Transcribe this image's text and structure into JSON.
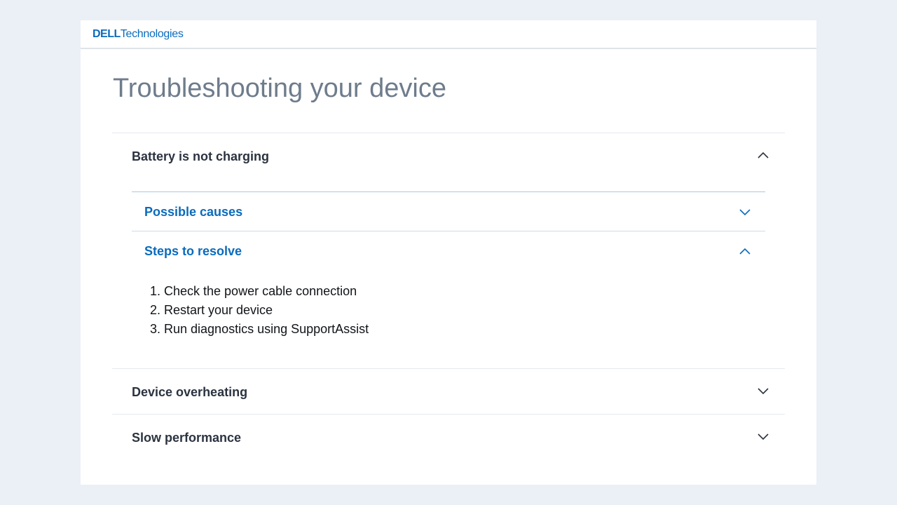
{
  "brand": {
    "logo_dell": "DELL",
    "logo_tech": "Technologies",
    "color": "#0a6bbd"
  },
  "page": {
    "title": "Troubleshooting your device"
  },
  "accordion": {
    "items": [
      {
        "title": "Battery is not charging",
        "expanded": true,
        "icon": "chevron-up-icon",
        "sub_items": [
          {
            "title": "Possible causes",
            "expanded": false,
            "icon": "chevron-down-icon"
          },
          {
            "title": "Steps to resolve",
            "expanded": true,
            "icon": "chevron-up-icon",
            "steps": [
              "Check the power cable connection",
              "Restart your device",
              "Run diagnostics using SupportAssist"
            ]
          }
        ]
      },
      {
        "title": "Device overheating",
        "expanded": false,
        "icon": "chevron-down-icon"
      },
      {
        "title": "Slow performance",
        "expanded": false,
        "icon": "chevron-down-icon"
      }
    ]
  },
  "colors": {
    "background": "#ebf0f7",
    "title_text": "#6e7c8c",
    "heading_text": "#2b3340",
    "link_blue": "#0a6bbd"
  }
}
